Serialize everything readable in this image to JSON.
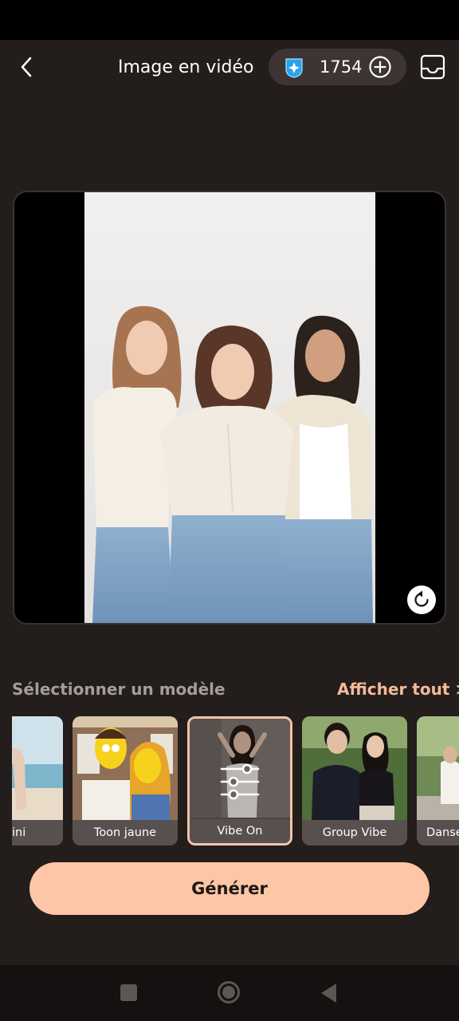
{
  "header": {
    "title": "Image en vidéo",
    "credits": "1754",
    "icons": {
      "back": "chevron-left-icon",
      "gem": "gem-icon",
      "add": "add-circle-icon",
      "inbox": "inbox-icon"
    }
  },
  "preview": {
    "icons": {
      "rotate": "rotate-icon"
    }
  },
  "templates": {
    "section_label": "Sélectionner un modèle",
    "see_all_label": "Afficher tout >",
    "items": [
      {
        "label": "ini",
        "selected": false
      },
      {
        "label": "Toon jaune",
        "selected": false
      },
      {
        "label": "Vibe On",
        "selected": true
      },
      {
        "label": "Group Vibe",
        "selected": false
      },
      {
        "label": "Danse",
        "selected": false
      }
    ]
  },
  "actions": {
    "generate_label": "Générer"
  },
  "colors": {
    "background": "#231d1b",
    "accent": "#fdc6a6",
    "link": "#f5b999",
    "pill": "#3c3533",
    "gem": "#27a3ef"
  }
}
